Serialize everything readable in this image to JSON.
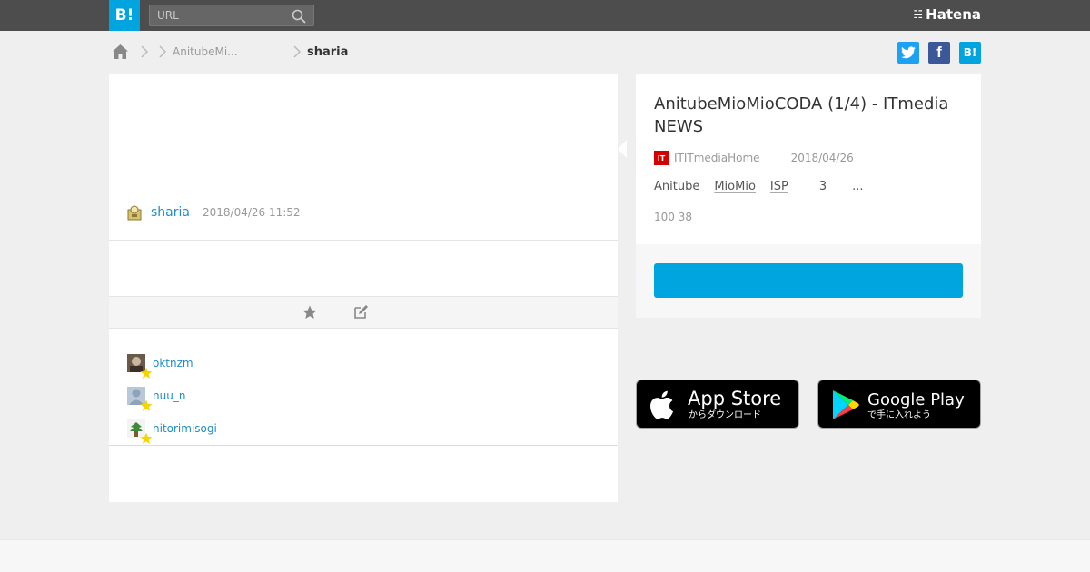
{
  "header": {
    "logo_text": "B!",
    "search_placeholder": "URL",
    "brand": "Hatena",
    "brand_icon": "hatena-icon"
  },
  "breadcrumb": {
    "item1": "AnitubeMi...",
    "current": "sharia"
  },
  "share": {
    "twitter": "t",
    "facebook": "f",
    "hatena": "B!"
  },
  "comment": {
    "user": "sharia",
    "date": "2018/04/26 11:52"
  },
  "stars": [
    {
      "name": "oktnzm"
    },
    {
      "name": "nuu_n"
    },
    {
      "name": "hitorimisogi"
    }
  ],
  "entry": {
    "title": "AnitubeMioMioCODA (1/4) - ITmedia NEWS",
    "favicon_text": "IT",
    "site": "ITITmediaHome",
    "date": "2018/04/26",
    "tags": [
      "Anitube",
      "MioMio",
      "ISP",
      "3",
      "..."
    ],
    "count": "100 38"
  },
  "stores": {
    "appstore_title": "App Store",
    "appstore_sub": "からダウンロード",
    "gplay_title": "Google Play",
    "gplay_sub": "で手に入れよう"
  },
  "colors": {
    "accent": "#00a4de",
    "topbar": "#4d4d4d",
    "link": "#1f8ec8"
  }
}
